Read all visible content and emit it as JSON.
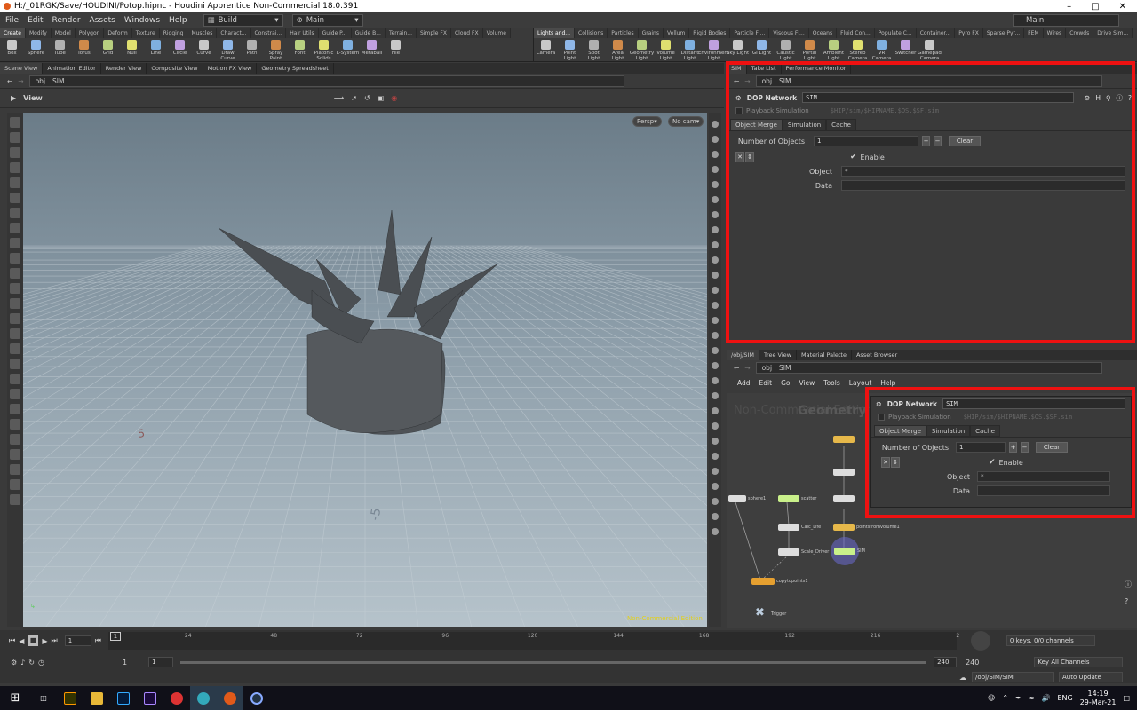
{
  "window": {
    "title": "H:/_01RGK/Save/HOUDINI/Potop.hipnc - Houdini Apprentice Non-Commercial 18.0.391"
  },
  "menu": {
    "items": [
      "File",
      "Edit",
      "Render",
      "Assets",
      "Windows",
      "Help"
    ],
    "desktop": "Build",
    "workspace": "Main",
    "right_desktop": "Main"
  },
  "shelf": {
    "left_tabs": [
      "Create",
      "Modify",
      "Model",
      "Polygon",
      "Deform",
      "Texture",
      "Rigging",
      "Muscles",
      "Charact...",
      "Constrai...",
      "Hair Utils",
      "Guide P...",
      "Guide B...",
      "Terrain...",
      "Simple FX",
      "Cloud FX",
      "Volume"
    ],
    "left_tools": [
      "Box",
      "Sphere",
      "Tube",
      "Torus",
      "Grid",
      "Null",
      "Line",
      "Circle",
      "Curve",
      "Draw Curve",
      "Path",
      "Spray Paint",
      "Font",
      "Platonic Solids",
      "L-System",
      "Metaball",
      "File"
    ],
    "right_tabs": [
      "Lights and...",
      "Collisions",
      "Particles",
      "Grains",
      "Vellum",
      "Rigid Bodies",
      "Particle Fl...",
      "Viscous Fl...",
      "Oceans",
      "Fluid Con...",
      "Populate C...",
      "Container...",
      "Pyro FX",
      "Sparse Pyr...",
      "FEM",
      "Wires",
      "Crowds",
      "Drive Sim..."
    ],
    "right_tools": [
      "Camera",
      "Point Light",
      "Spot Light",
      "Area Light",
      "Geometry Light",
      "Volume Light",
      "Distant Light",
      "Environment Light",
      "Sky Light",
      "GI Light",
      "Caustic Light",
      "Portal Light",
      "Ambient Light",
      "Stereo Camera",
      "VR Camera",
      "Switcher",
      "Gamepad Camera"
    ]
  },
  "left_pane": {
    "tabs": [
      "Scene View",
      "Animation Editor",
      "Render View",
      "Composite View",
      "Motion FX View",
      "Geometry Spreadsheet"
    ],
    "path": [
      "obj",
      "SIM"
    ],
    "view_label": "View",
    "persp": "Persp",
    "cam": "No cam",
    "watermark": "Non-Commercial Edition",
    "grid_labels": [
      "5",
      "-5"
    ]
  },
  "param_pane": {
    "tabs": [
      "SIM",
      "Take List",
      "Performance Monitor"
    ],
    "path": [
      "obj",
      "SIM"
    ],
    "node_type": "DOP Network",
    "node_name": "SIM",
    "playback_label": "Playback Simulation",
    "playback_path": "$HIP/sim/$HIPNAME.$OS.$SF.sim",
    "subtabs": [
      "Object Merge",
      "Simulation",
      "Cache"
    ],
    "num_objects_label": "Number of Objects",
    "num_objects": "1",
    "clear": "Clear",
    "enable": "Enable",
    "object_label": "Object",
    "object_value": "*",
    "data_label": "Data",
    "data_value": ""
  },
  "network_pane": {
    "tabs": [
      "/obj/SIM",
      "Tree View",
      "Material Palette",
      "Asset Browser"
    ],
    "path": [
      "obj",
      "SIM"
    ],
    "menu": [
      "Add",
      "Edit",
      "Go",
      "View",
      "Tools",
      "Layout",
      "Help"
    ],
    "bg_text_1": "Non-Commercial Edition",
    "bg_text_2": "Geometry",
    "nodes": [
      "sphere1",
      "scatter",
      "Calc_Life",
      "Scale_Driver",
      "copytopoints1",
      "Trigger",
      "pointsfromvolume1",
      "SIM"
    ]
  },
  "timeline": {
    "frame": "1",
    "ticks": [
      "24",
      "48",
      "72",
      "96",
      "120",
      "144",
      "168",
      "192",
      "216",
      "2"
    ],
    "start": "1",
    "start2": "1",
    "end": "240",
    "end2": "240",
    "keys": "0 keys, 0/0 channels",
    "key_all": "Key All Channels",
    "path": "/obj/SIM/SIM",
    "auto_update": "Auto Update"
  },
  "taskbar": {
    "lang": "ENG",
    "time": "14:19",
    "date": "29-Mar-21"
  }
}
